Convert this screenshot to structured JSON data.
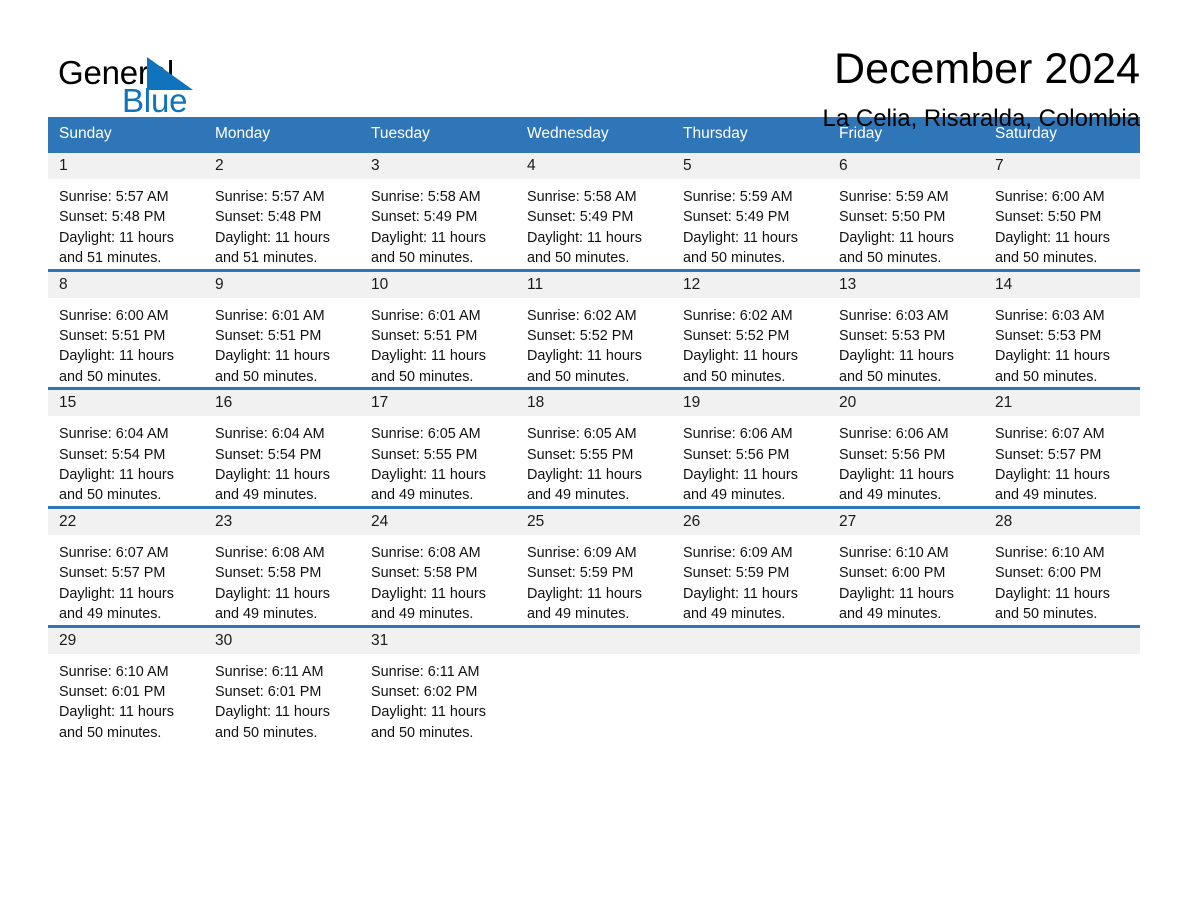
{
  "brand": {
    "word1": "General",
    "word2": "Blue",
    "triangle_color": "#1073bd",
    "text_color": "#000000",
    "blue_text_color": "#1073bd"
  },
  "header": {
    "title": "December 2024",
    "subtitle": "La Celia, Risaralda, Colombia"
  },
  "theme": {
    "header_blue": "#2e76b8",
    "day_band_gray": "#f1f1f1",
    "row_rule_blue": "#2e76b8"
  },
  "weekdays": [
    "Sunday",
    "Monday",
    "Tuesday",
    "Wednesday",
    "Thursday",
    "Friday",
    "Saturday"
  ],
  "weeks": [
    [
      {
        "day": "1",
        "sunrise": "Sunrise: 5:57 AM",
        "sunset": "Sunset: 5:48 PM",
        "daylight1": "Daylight: 11 hours",
        "daylight2": "and 51 minutes."
      },
      {
        "day": "2",
        "sunrise": "Sunrise: 5:57 AM",
        "sunset": "Sunset: 5:48 PM",
        "daylight1": "Daylight: 11 hours",
        "daylight2": "and 51 minutes."
      },
      {
        "day": "3",
        "sunrise": "Sunrise: 5:58 AM",
        "sunset": "Sunset: 5:49 PM",
        "daylight1": "Daylight: 11 hours",
        "daylight2": "and 50 minutes."
      },
      {
        "day": "4",
        "sunrise": "Sunrise: 5:58 AM",
        "sunset": "Sunset: 5:49 PM",
        "daylight1": "Daylight: 11 hours",
        "daylight2": "and 50 minutes."
      },
      {
        "day": "5",
        "sunrise": "Sunrise: 5:59 AM",
        "sunset": "Sunset: 5:49 PM",
        "daylight1": "Daylight: 11 hours",
        "daylight2": "and 50 minutes."
      },
      {
        "day": "6",
        "sunrise": "Sunrise: 5:59 AM",
        "sunset": "Sunset: 5:50 PM",
        "daylight1": "Daylight: 11 hours",
        "daylight2": "and 50 minutes."
      },
      {
        "day": "7",
        "sunrise": "Sunrise: 6:00 AM",
        "sunset": "Sunset: 5:50 PM",
        "daylight1": "Daylight: 11 hours",
        "daylight2": "and 50 minutes."
      }
    ],
    [
      {
        "day": "8",
        "sunrise": "Sunrise: 6:00 AM",
        "sunset": "Sunset: 5:51 PM",
        "daylight1": "Daylight: 11 hours",
        "daylight2": "and 50 minutes."
      },
      {
        "day": "9",
        "sunrise": "Sunrise: 6:01 AM",
        "sunset": "Sunset: 5:51 PM",
        "daylight1": "Daylight: 11 hours",
        "daylight2": "and 50 minutes."
      },
      {
        "day": "10",
        "sunrise": "Sunrise: 6:01 AM",
        "sunset": "Sunset: 5:51 PM",
        "daylight1": "Daylight: 11 hours",
        "daylight2": "and 50 minutes."
      },
      {
        "day": "11",
        "sunrise": "Sunrise: 6:02 AM",
        "sunset": "Sunset: 5:52 PM",
        "daylight1": "Daylight: 11 hours",
        "daylight2": "and 50 minutes."
      },
      {
        "day": "12",
        "sunrise": "Sunrise: 6:02 AM",
        "sunset": "Sunset: 5:52 PM",
        "daylight1": "Daylight: 11 hours",
        "daylight2": "and 50 minutes."
      },
      {
        "day": "13",
        "sunrise": "Sunrise: 6:03 AM",
        "sunset": "Sunset: 5:53 PM",
        "daylight1": "Daylight: 11 hours",
        "daylight2": "and 50 minutes."
      },
      {
        "day": "14",
        "sunrise": "Sunrise: 6:03 AM",
        "sunset": "Sunset: 5:53 PM",
        "daylight1": "Daylight: 11 hours",
        "daylight2": "and 50 minutes."
      }
    ],
    [
      {
        "day": "15",
        "sunrise": "Sunrise: 6:04 AM",
        "sunset": "Sunset: 5:54 PM",
        "daylight1": "Daylight: 11 hours",
        "daylight2": "and 50 minutes."
      },
      {
        "day": "16",
        "sunrise": "Sunrise: 6:04 AM",
        "sunset": "Sunset: 5:54 PM",
        "daylight1": "Daylight: 11 hours",
        "daylight2": "and 49 minutes."
      },
      {
        "day": "17",
        "sunrise": "Sunrise: 6:05 AM",
        "sunset": "Sunset: 5:55 PM",
        "daylight1": "Daylight: 11 hours",
        "daylight2": "and 49 minutes."
      },
      {
        "day": "18",
        "sunrise": "Sunrise: 6:05 AM",
        "sunset": "Sunset: 5:55 PM",
        "daylight1": "Daylight: 11 hours",
        "daylight2": "and 49 minutes."
      },
      {
        "day": "19",
        "sunrise": "Sunrise: 6:06 AM",
        "sunset": "Sunset: 5:56 PM",
        "daylight1": "Daylight: 11 hours",
        "daylight2": "and 49 minutes."
      },
      {
        "day": "20",
        "sunrise": "Sunrise: 6:06 AM",
        "sunset": "Sunset: 5:56 PM",
        "daylight1": "Daylight: 11 hours",
        "daylight2": "and 49 minutes."
      },
      {
        "day": "21",
        "sunrise": "Sunrise: 6:07 AM",
        "sunset": "Sunset: 5:57 PM",
        "daylight1": "Daylight: 11 hours",
        "daylight2": "and 49 minutes."
      }
    ],
    [
      {
        "day": "22",
        "sunrise": "Sunrise: 6:07 AM",
        "sunset": "Sunset: 5:57 PM",
        "daylight1": "Daylight: 11 hours",
        "daylight2": "and 49 minutes."
      },
      {
        "day": "23",
        "sunrise": "Sunrise: 6:08 AM",
        "sunset": "Sunset: 5:58 PM",
        "daylight1": "Daylight: 11 hours",
        "daylight2": "and 49 minutes."
      },
      {
        "day": "24",
        "sunrise": "Sunrise: 6:08 AM",
        "sunset": "Sunset: 5:58 PM",
        "daylight1": "Daylight: 11 hours",
        "daylight2": "and 49 minutes."
      },
      {
        "day": "25",
        "sunrise": "Sunrise: 6:09 AM",
        "sunset": "Sunset: 5:59 PM",
        "daylight1": "Daylight: 11 hours",
        "daylight2": "and 49 minutes."
      },
      {
        "day": "26",
        "sunrise": "Sunrise: 6:09 AM",
        "sunset": "Sunset: 5:59 PM",
        "daylight1": "Daylight: 11 hours",
        "daylight2": "and 49 minutes."
      },
      {
        "day": "27",
        "sunrise": "Sunrise: 6:10 AM",
        "sunset": "Sunset: 6:00 PM",
        "daylight1": "Daylight: 11 hours",
        "daylight2": "and 49 minutes."
      },
      {
        "day": "28",
        "sunrise": "Sunrise: 6:10 AM",
        "sunset": "Sunset: 6:00 PM",
        "daylight1": "Daylight: 11 hours",
        "daylight2": "and 50 minutes."
      }
    ],
    [
      {
        "day": "29",
        "sunrise": "Sunrise: 6:10 AM",
        "sunset": "Sunset: 6:01 PM",
        "daylight1": "Daylight: 11 hours",
        "daylight2": "and 50 minutes."
      },
      {
        "day": "30",
        "sunrise": "Sunrise: 6:11 AM",
        "sunset": "Sunset: 6:01 PM",
        "daylight1": "Daylight: 11 hours",
        "daylight2": "and 50 minutes."
      },
      {
        "day": "31",
        "sunrise": "Sunrise: 6:11 AM",
        "sunset": "Sunset: 6:02 PM",
        "daylight1": "Daylight: 11 hours",
        "daylight2": "and 50 minutes."
      },
      {
        "day": "",
        "sunrise": "",
        "sunset": "",
        "daylight1": "",
        "daylight2": ""
      },
      {
        "day": "",
        "sunrise": "",
        "sunset": "",
        "daylight1": "",
        "daylight2": ""
      },
      {
        "day": "",
        "sunrise": "",
        "sunset": "",
        "daylight1": "",
        "daylight2": ""
      },
      {
        "day": "",
        "sunrise": "",
        "sunset": "",
        "daylight1": "",
        "daylight2": ""
      }
    ]
  ]
}
